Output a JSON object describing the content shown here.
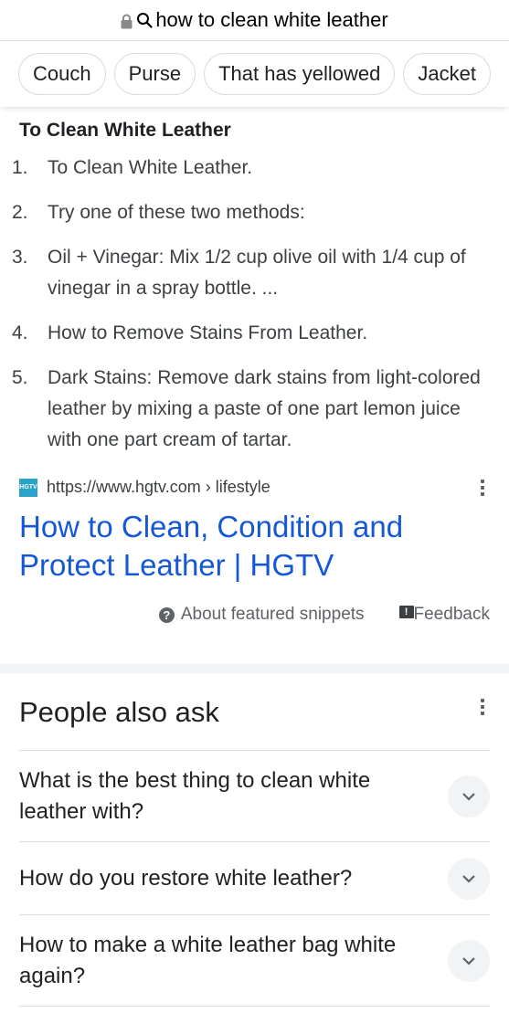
{
  "url_bar": {
    "lock_icon": "lock-icon",
    "search_icon": "search-icon",
    "query": "how to clean white leather"
  },
  "chips": [
    "Couch",
    "Purse",
    "That has yellowed",
    "Jacket"
  ],
  "featured_snippet": {
    "title": "To Clean White Leather",
    "steps": [
      {
        "num": "1.",
        "text": "To Clean White Leather."
      },
      {
        "num": "2.",
        "text": "Try one of these two methods:"
      },
      {
        "num": "3.",
        "text": "Oil + Vinegar: Mix 1/2 cup olive oil with 1/4 cup of vinegar in a spray bottle. ..."
      },
      {
        "num": "4.",
        "text": "How to Remove Stains From Leather."
      },
      {
        "num": "5.",
        "text": "Dark Stains: Remove dark stains from light-colored leather by mixing a paste of one part lemon juice with one part cream of tartar."
      }
    ],
    "source": {
      "favicon_text": "HGTV",
      "breadcrumb": "https://www.hgtv.com › lifestyle",
      "title": "How to Clean, Condition and Protect Leather | HGTV"
    },
    "footer": {
      "about_label": "About featured snippets",
      "feedback_label": "Feedback"
    }
  },
  "people_also_ask": {
    "title": "People also ask",
    "questions": [
      "What is the best thing to clean white leather with?",
      "How do you restore white leather?",
      "How to make a white leather bag white again?"
    ]
  },
  "colors": {
    "link": "#1558d6",
    "text": "#202124",
    "divider": "#dadce0",
    "band": "#f1f3f4",
    "favicon_bg": "#2aa3c9"
  }
}
